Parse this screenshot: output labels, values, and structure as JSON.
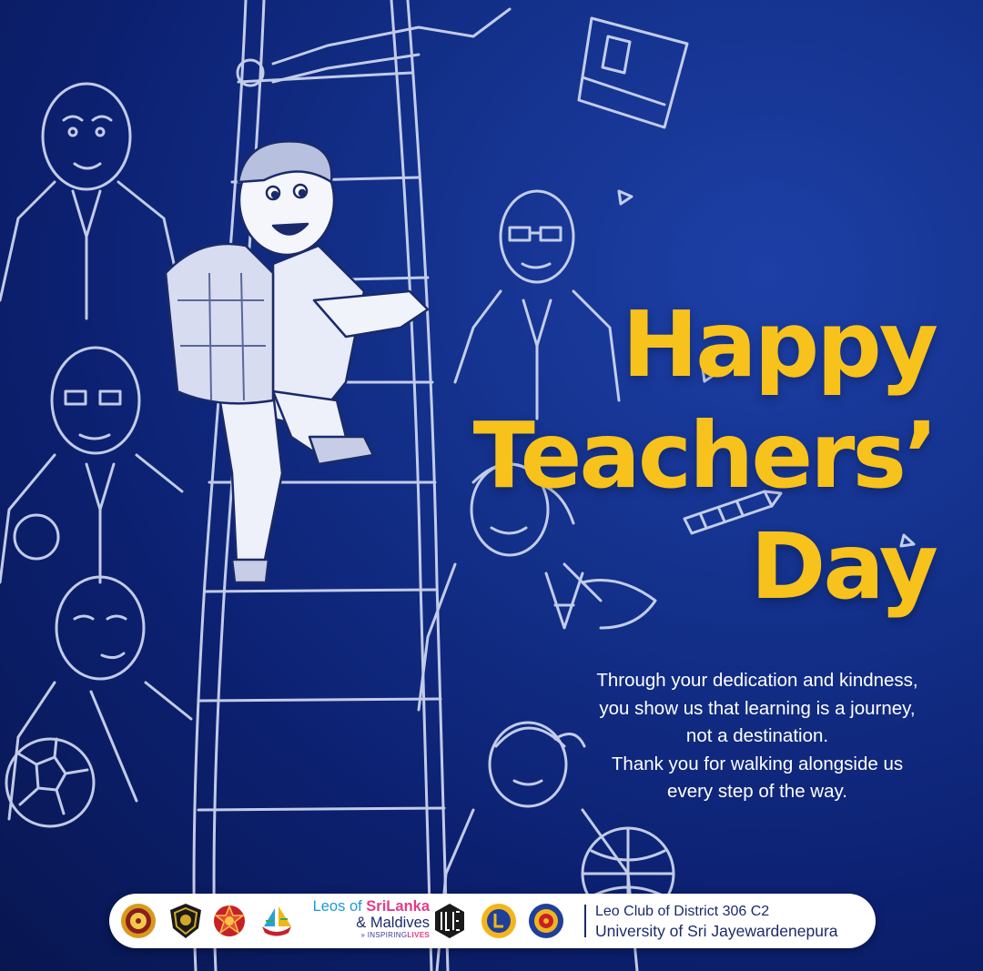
{
  "poster": {
    "headline": [
      "Happy",
      "Teachers’",
      "Day"
    ],
    "message": [
      "Through your dedication and kindness,",
      "you show us that learning is a journey,",
      "not a destination.",
      "Thank you for walking alongside us",
      "every step of the way."
    ]
  },
  "illustration": {
    "subjects": [
      "boy-with-backpack",
      "rope-ladder",
      "teacher-figures",
      "soccer-ball",
      "globe",
      "pencil",
      "book"
    ]
  },
  "footer": {
    "brand": {
      "line1_a": "Leos of ",
      "line1_b": "SriLanka",
      "line2": "& Maldives",
      "tagline_a": "INSPIRING",
      "tagline_b": "LIVES"
    },
    "club_line1": "Leo Club of District 306 C2",
    "club_line2": "University of Sri Jayewardenepura",
    "logos": [
      "university-seal-icon",
      "leo-crest-icon",
      "lotus-emblem-icon",
      "ship-emblem-icon",
      "leo-logo-icon",
      "lions-international-icon",
      "district-seal-icon"
    ]
  },
  "colors": {
    "headline": "#f7c21b",
    "background": "#13308a",
    "line_art": "#d6def5",
    "text": "#ffffff",
    "footer_text": "#1b2b6b"
  }
}
